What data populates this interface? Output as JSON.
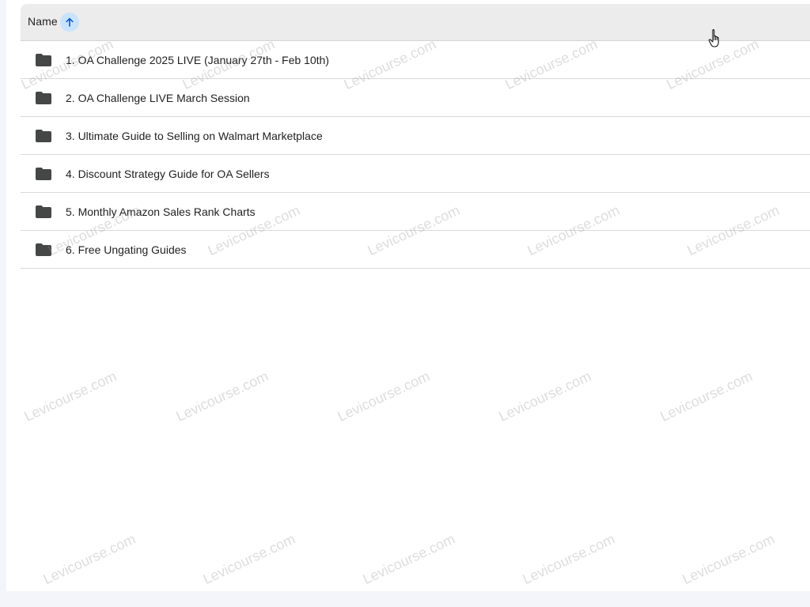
{
  "header": {
    "column_label": "Name",
    "sort_icon": "arrow-up-icon",
    "sort_direction": "ascending"
  },
  "folder_icon": "folder-icon",
  "rows": [
    {
      "label": "1. OA Challenge 2025 LIVE (January 27th - Feb 10th)"
    },
    {
      "label": "2. OA Challenge LIVE March Session"
    },
    {
      "label": "3. Ultimate Guide to Selling on Walmart Marketplace"
    },
    {
      "label": "4. Discount Strategy Guide for OA Sellers"
    },
    {
      "label": "5. Monthly Amazon Sales Rank Charts"
    },
    {
      "label": "6. Free Ungating Guides"
    }
  ],
  "watermark": {
    "text": "Levicourse.com"
  },
  "colors": {
    "sort_accent": "#0b57d0",
    "sort_bg": "#c8e3fb",
    "folder": "#444746"
  }
}
